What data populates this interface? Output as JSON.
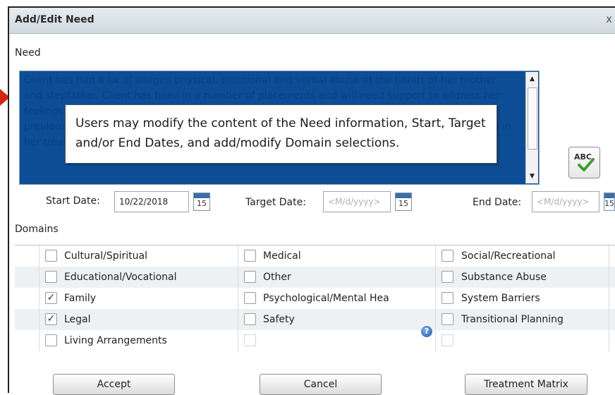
{
  "dialog": {
    "title": "Add/Edit Need",
    "close_label": "x"
  },
  "need": {
    "label": "Need",
    "text": "Client has had a hx of alleged physical, emotional and verbal abuse at the hands of her mother and stepfather. Client has been in a number of placements and will need support to address her feelings of sadness, anger and frustration that she has been experiencing as a result of her previous and current situations. Client will need to work through these feelings to move forward in her treatment.",
    "callout": "Users may modify the content of the Need information, Start, Target and/or End Dates, and add/modify Domain selections.",
    "spell_check_label": "ABC"
  },
  "dates": {
    "start_label": "Start Date:",
    "start_value": "10/22/2018",
    "target_label": "Target Date:",
    "target_placeholder": "<M/d/yyyy>",
    "end_label": "End Date:",
    "end_placeholder": "<M/d/yyyy>",
    "calendar_day": "15"
  },
  "domains": {
    "label": "Domains",
    "check_mark": "✓",
    "columns": [
      [
        {
          "label": "Cultural/Spiritual",
          "checked": false
        },
        {
          "label": "Educational/Vocational",
          "checked": false
        },
        {
          "label": "Family",
          "checked": true
        },
        {
          "label": "Legal",
          "checked": true
        },
        {
          "label": "Living Arrangements",
          "checked": false
        }
      ],
      [
        {
          "label": "Medical",
          "checked": false
        },
        {
          "label": "Other",
          "checked": false
        },
        {
          "label": "Psychological/Mental Hea",
          "checked": false
        },
        {
          "label": "Safety",
          "checked": false
        }
      ],
      [
        {
          "label": "Social/Recreational",
          "checked": false
        },
        {
          "label": "Substance Abuse",
          "checked": false
        },
        {
          "label": "System Barriers",
          "checked": false
        },
        {
          "label": "Transitional Planning",
          "checked": false
        }
      ]
    ]
  },
  "buttons": {
    "accept": "Accept",
    "cancel": "Cancel",
    "treatment_matrix": "Treatment Matrix"
  },
  "colors": {
    "need_selection_bg": "#0d4d96",
    "arrow": "#d3270f"
  }
}
